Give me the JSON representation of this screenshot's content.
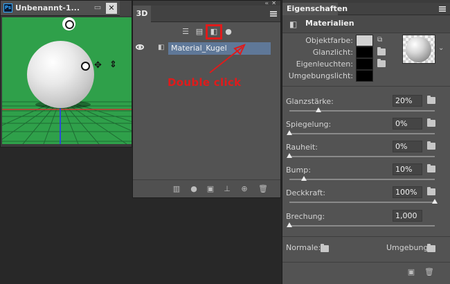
{
  "document": {
    "app_badge": "Ps",
    "title": "Unbenannt-1...",
    "minimize": "▭",
    "close": "✕"
  },
  "panel_3d": {
    "tab": "3D",
    "collapse": "‹‹",
    "close": "✕",
    "filter_icons": [
      "scene-filter-icon",
      "mesh-filter-icon",
      "material-filter-icon",
      "light-filter-icon"
    ],
    "layer_name": "Material_Kugel",
    "bottom_icons": [
      "mesh-icon",
      "light-icon",
      "render-icon",
      "ground-icon",
      "add-object-icon",
      "trash-icon"
    ]
  },
  "annotation": {
    "text": "Double click",
    "color": "#e01b1b"
  },
  "properties": {
    "tab": "Eigenschaften",
    "section_title": "Materialien",
    "colors": [
      {
        "label": "Objektfarbe:",
        "value": "#d2d2d2"
      },
      {
        "label": "Glanzlicht:",
        "value": "#000000"
      },
      {
        "label": "Eigenleuchten:",
        "value": "#000000"
      },
      {
        "label": "Umgebungslicht:",
        "value": "#000000"
      }
    ],
    "sliders": [
      {
        "label": "Glanzstärke:",
        "value": "20%",
        "fraction": 0.2
      },
      {
        "label": "Spiegelung:",
        "value": "0%",
        "fraction": 0.0
      },
      {
        "label": "Rauheit:",
        "value": "0%",
        "fraction": 0.0
      },
      {
        "label": "Bump:",
        "value": "10%",
        "fraction": 0.1
      },
      {
        "label": "Deckkraft:",
        "value": "100%",
        "fraction": 1.0
      },
      {
        "label": "Brechung:",
        "value": "1,000",
        "fraction": 0.0
      }
    ],
    "normal_label": "Normale:",
    "environment_label": "Umgebung:",
    "bottom_icons": [
      "render-material-icon",
      "trash-icon"
    ]
  },
  "colors": {
    "panel_bg": "#535353",
    "canvas_green": "#2fa04a",
    "selection_blue": "#5f7898",
    "highlight_red": "#e01b1b"
  }
}
